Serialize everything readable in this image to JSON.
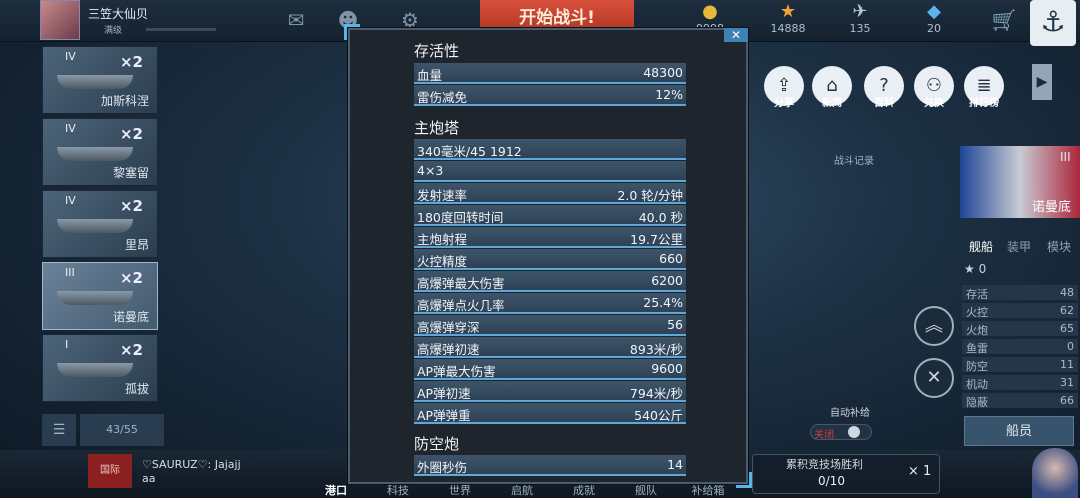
{
  "top": {
    "player_name": "三笠大仙贝",
    "player_rank": "满级",
    "start_battle": "开始战斗!",
    "resources": [
      {
        "icon": "coin-icon",
        "value": "9998"
      },
      {
        "icon": "star-icon",
        "value": "14888"
      },
      {
        "icon": "plane-icon",
        "value": "135"
      },
      {
        "icon": "crystal-icon",
        "value": "20"
      }
    ]
  },
  "ships": [
    {
      "tier": "IV",
      "count": "×2",
      "name": "加斯科涅"
    },
    {
      "tier": "IV",
      "count": "×2",
      "name": "黎塞留"
    },
    {
      "tier": "IV",
      "count": "×2",
      "name": "里昂"
    },
    {
      "tier": "III",
      "count": "×2",
      "name": "诺曼底"
    },
    {
      "tier": "I",
      "count": "×2",
      "name": "孤拔"
    }
  ],
  "list_count": "43/55",
  "chat": {
    "badge": "国际",
    "line1": "♡SAURUZ♡: Jajajj",
    "line2": "aa"
  },
  "nav": [
    "港口",
    "科技",
    "世界",
    "启航",
    "成就",
    "舰队",
    "补给箱"
  ],
  "reward": {
    "title": "累积竞技场胜利",
    "progress": "0/10",
    "multiplier": "× 1"
  },
  "menu": [
    "分享",
    "新闻",
    "百科",
    "兑换",
    "排行榜"
  ],
  "battle_record": "战斗记录",
  "preview": {
    "tier": "III",
    "name": "诺曼底"
  },
  "tabs": [
    "舰船",
    "装甲",
    "模块"
  ],
  "stars": "★ 0",
  "stats": [
    {
      "k": "存活",
      "v": "48"
    },
    {
      "k": "火控",
      "v": "62"
    },
    {
      "k": "火炮",
      "v": "65"
    },
    {
      "k": "鱼雷",
      "v": "0"
    },
    {
      "k": "防空",
      "v": "11"
    },
    {
      "k": "机动",
      "v": "31"
    },
    {
      "k": "隐蔽",
      "v": "66"
    }
  ],
  "crew_button": "船员",
  "auto_repair": "自动补给",
  "toggle_off": "关闭",
  "modal": {
    "survivability": {
      "title": "存活性",
      "rows": [
        {
          "k": "血量",
          "v": "48300"
        },
        {
          "k": "雷伤减免",
          "v": "12%"
        }
      ]
    },
    "turret": {
      "title": "主炮塔",
      "rows": [
        {
          "k": "340毫米/45 1912",
          "v": ""
        },
        {
          "k": "4×3",
          "v": ""
        },
        {
          "k": "发射速率",
          "v": "2.0 轮/分钟"
        },
        {
          "k": "180度回转时间",
          "v": "40.0 秒"
        },
        {
          "k": "主炮射程",
          "v": "19.7公里"
        },
        {
          "k": "火控精度",
          "v": "660"
        },
        {
          "k": "高爆弹最大伤害",
          "v": "6200"
        },
        {
          "k": "高爆弹点火几率",
          "v": "25.4%"
        },
        {
          "k": "高爆弹穿深",
          "v": "56"
        },
        {
          "k": "高爆弹初速",
          "v": "893米/秒"
        },
        {
          "k": "AP弹最大伤害",
          "v": "9600"
        },
        {
          "k": "AP弹初速",
          "v": "794米/秒"
        },
        {
          "k": "AP弹弹重",
          "v": "540公斤"
        }
      ]
    },
    "aa": {
      "title": "防空炮",
      "rows": [
        {
          "k": "外圈秒伤",
          "v": "14"
        }
      ]
    }
  }
}
